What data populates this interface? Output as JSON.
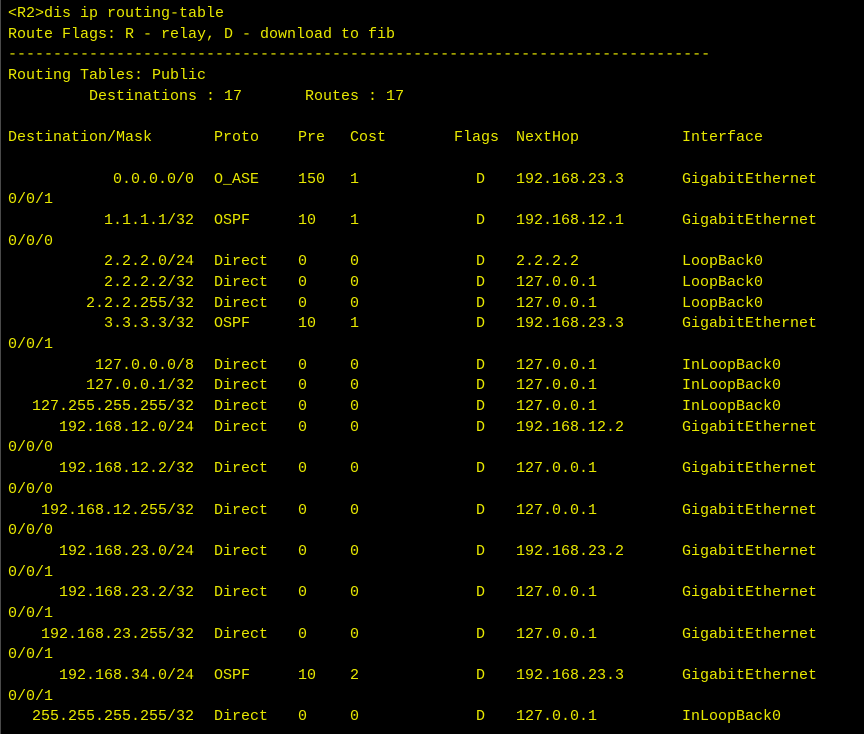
{
  "terminal": {
    "prompt": "<R2>dis ip routing-table",
    "route_flags": "Route Flags: R - relay, D - download to fib",
    "separator": "------------------------------------------------------------------------------",
    "table_name": "Routing Tables: Public",
    "summary": "         Destinations : 17       Routes : 17",
    "headers": {
      "destination": "Destination/Mask",
      "proto": "Proto",
      "pre": "Pre",
      "cost": "Cost",
      "flags": "Flags",
      "nexthop": "NextHop",
      "interface": "Interface"
    },
    "routes": [
      {
        "dest": "0.0.0.0/0",
        "proto": "O_ASE",
        "pre": "150",
        "cost": "1",
        "flags": "D",
        "nexthop": "192.168.23.3",
        "iface": "GigabitEthernet",
        "wrap": "0/0/1"
      },
      {
        "dest": "1.1.1.1/32",
        "proto": "OSPF",
        "pre": "10",
        "cost": "1",
        "flags": "D",
        "nexthop": "192.168.12.1",
        "iface": "GigabitEthernet",
        "wrap": "0/0/0"
      },
      {
        "dest": "2.2.2.0/24",
        "proto": "Direct",
        "pre": "0",
        "cost": "0",
        "flags": "D",
        "nexthop": "2.2.2.2",
        "iface": "LoopBack0",
        "wrap": ""
      },
      {
        "dest": "2.2.2.2/32",
        "proto": "Direct",
        "pre": "0",
        "cost": "0",
        "flags": "D",
        "nexthop": "127.0.0.1",
        "iface": "LoopBack0",
        "wrap": ""
      },
      {
        "dest": "2.2.2.255/32",
        "proto": "Direct",
        "pre": "0",
        "cost": "0",
        "flags": "D",
        "nexthop": "127.0.0.1",
        "iface": "LoopBack0",
        "wrap": ""
      },
      {
        "dest": "3.3.3.3/32",
        "proto": "OSPF",
        "pre": "10",
        "cost": "1",
        "flags": "D",
        "nexthop": "192.168.23.3",
        "iface": "GigabitEthernet",
        "wrap": "0/0/1"
      },
      {
        "dest": "127.0.0.0/8",
        "proto": "Direct",
        "pre": "0",
        "cost": "0",
        "flags": "D",
        "nexthop": "127.0.0.1",
        "iface": "InLoopBack0",
        "wrap": ""
      },
      {
        "dest": "127.0.0.1/32",
        "proto": "Direct",
        "pre": "0",
        "cost": "0",
        "flags": "D",
        "nexthop": "127.0.0.1",
        "iface": "InLoopBack0",
        "wrap": ""
      },
      {
        "dest": "127.255.255.255/32",
        "proto": "Direct",
        "pre": "0",
        "cost": "0",
        "flags": "D",
        "nexthop": "127.0.0.1",
        "iface": "InLoopBack0",
        "wrap": ""
      },
      {
        "dest": "192.168.12.0/24",
        "proto": "Direct",
        "pre": "0",
        "cost": "0",
        "flags": "D",
        "nexthop": "192.168.12.2",
        "iface": "GigabitEthernet",
        "wrap": "0/0/0"
      },
      {
        "dest": "192.168.12.2/32",
        "proto": "Direct",
        "pre": "0",
        "cost": "0",
        "flags": "D",
        "nexthop": "127.0.0.1",
        "iface": "GigabitEthernet",
        "wrap": "0/0/0"
      },
      {
        "dest": "192.168.12.255/32",
        "proto": "Direct",
        "pre": "0",
        "cost": "0",
        "flags": "D",
        "nexthop": "127.0.0.1",
        "iface": "GigabitEthernet",
        "wrap": "0/0/0"
      },
      {
        "dest": "192.168.23.0/24",
        "proto": "Direct",
        "pre": "0",
        "cost": "0",
        "flags": "D",
        "nexthop": "192.168.23.2",
        "iface": "GigabitEthernet",
        "wrap": "0/0/1"
      },
      {
        "dest": "192.168.23.2/32",
        "proto": "Direct",
        "pre": "0",
        "cost": "0",
        "flags": "D",
        "nexthop": "127.0.0.1",
        "iface": "GigabitEthernet",
        "wrap": "0/0/1"
      },
      {
        "dest": "192.168.23.255/32",
        "proto": "Direct",
        "pre": "0",
        "cost": "0",
        "flags": "D",
        "nexthop": "127.0.0.1",
        "iface": "GigabitEthernet",
        "wrap": "0/0/1"
      },
      {
        "dest": "192.168.34.0/24",
        "proto": "OSPF",
        "pre": "10",
        "cost": "2",
        "flags": "D",
        "nexthop": "192.168.23.3",
        "iface": "GigabitEthernet",
        "wrap": "0/0/1"
      },
      {
        "dest": "255.255.255.255/32",
        "proto": "Direct",
        "pre": "0",
        "cost": "0",
        "flags": "D",
        "nexthop": "127.0.0.1",
        "iface": "InLoopBack0",
        "wrap": ""
      }
    ]
  },
  "colors": {
    "background": "#000000",
    "text": "#e8e800"
  }
}
